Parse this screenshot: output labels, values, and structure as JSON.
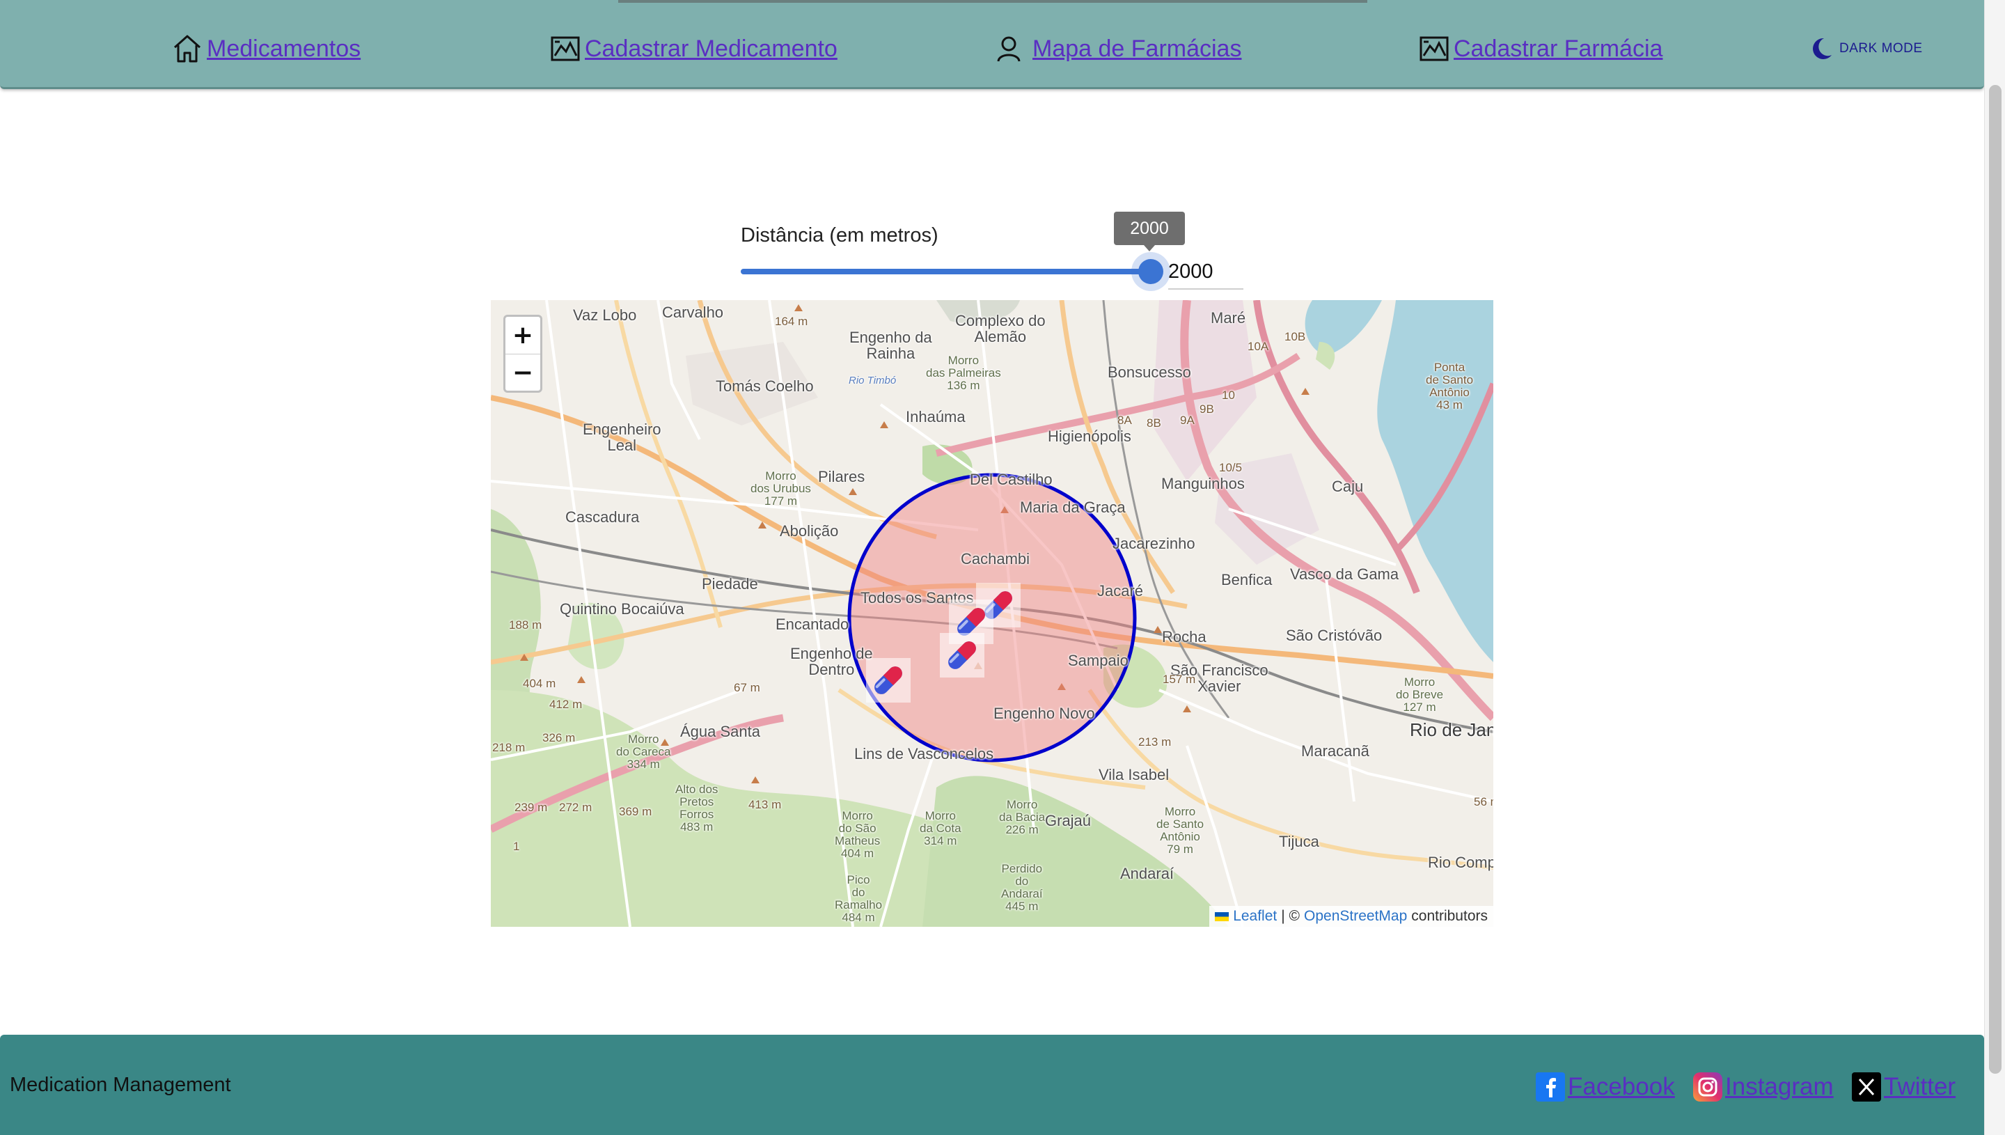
{
  "navbar": {
    "items": [
      {
        "label": "Medicamentos",
        "icon": "home-icon"
      },
      {
        "label": "Cadastrar Medicamento",
        "icon": "image-chart-icon"
      },
      {
        "label": "Mapa de Farmácias",
        "icon": "user-icon"
      },
      {
        "label": "Cadastrar Farmácia",
        "icon": "image-chart-icon"
      }
    ],
    "dark_mode": {
      "label": "DARK MODE",
      "icon": "moon-icon"
    }
  },
  "slider": {
    "label": "Distância (em metros)",
    "value": "2000",
    "tooltip": "2000",
    "fill_fraction": 1.0
  },
  "map": {
    "zoom_in": "+",
    "zoom_out": "−",
    "marker_icon": "pill-capsule-icon",
    "markers_count": 4,
    "attribution": {
      "leaflet": "Leaflet",
      "separator": "| ©",
      "osm": "OpenStreetMap",
      "suffix": "contributors"
    },
    "places": {
      "vaz_lobo": "Vaz Lobo",
      "carvalho": "Carvalho",
      "engenho_rainha": "Engenho da\nRainha",
      "complexo_alemao": "Complexo do\nAlemão",
      "mare": "Maré",
      "ponta": "Ponta\nde Santo\nAntônio\n43 m",
      "morro_palmeiras": "Morro\ndas Palmeiras\n136 m",
      "bonsucesso": "Bonsucesso",
      "tomas_coelho": "Tomás Coelho",
      "rio_timbo": "Rio Timbó",
      "inhauma": "Inhaúma",
      "higienopolis": "Higienópolis",
      "engenheiro_leal": "Engenheiro\nLeal",
      "pilares": "Pilares",
      "morro_urubus": "Morro\ndos Urubus\n177 m",
      "del_castilho": "Del Castilho",
      "manguinhos": "Manguinhos",
      "caju": "Caju",
      "cascadura": "Cascadura",
      "abolicao": "Abolição",
      "maria_graca": "Maria da Graça",
      "cachambi": "Cachambi",
      "jacarezinho": "Jacarezinho",
      "benfica": "Benfica",
      "vasco_gama": "Vasco da Gama",
      "piedade": "Piedade",
      "todos_santos": "Todos os Santos",
      "jacare": "Jacaré",
      "quintino": "Quintino Bocaiúva",
      "encantado": "Encantado",
      "rocha": "Rocha",
      "sao_cristovao": "São Cristóvão",
      "engenho_dentro": "Engenho de\nDentro",
      "sampaio": "Sampaio",
      "sao_francisco": "São Francisco\nXavier",
      "morro_breve": "Morro\ndo Breve\n127 m",
      "rio_janeiro": "Rio de Jan",
      "agua_santa": "Água Santa",
      "engenho_novo": "Engenho Novo",
      "morro_careca": "Morro\ndo Careca\n334 m",
      "lins": "Lins de Vasconcelos",
      "vila_isabel": "Vila Isabel",
      "maracana": "Maracanã",
      "alto_pretos": "Alto dos\nPretos\nForros\n483 m",
      "morro_matheus": "Morro\ndo São\nMatheus\n404 m",
      "morro_cota": "Morro\nda Cota\n314 m",
      "morro_bacia": "Morro\nda Bacia\n226 m",
      "grajau": "Grajaú",
      "morro_santo_antonio": "Morro\nde Santo\nAntônio\n79 m",
      "tijuca": "Tijuca",
      "rio_comp": "Rio Comp",
      "pico_ramalho": "Pico\ndo\nRamalho\n484 m",
      "perdido": "Perdido\ndo\nAndaraí\n445 m",
      "andarai": "Andaraí",
      "e188": "188 m",
      "e404": "404 m",
      "e412": "412 m",
      "e326": "326 m",
      "e218": "218 m",
      "e239": "239 m",
      "e272": "272 m",
      "e369": "369 m",
      "e413": "413 m",
      "e67": "67 m",
      "e164": "164 m",
      "e157": "157 m",
      "e213": "213 m",
      "e56": "56 m",
      "e10a": "10A",
      "e10b": "10B",
      "e8a": "8A",
      "e9a": "9A",
      "e9b": "9B",
      "e10": "10",
      "e8b": "8B",
      "e105": "10/5",
      "e1": "1"
    }
  },
  "footer": {
    "brand": "Medication Management",
    "social": [
      {
        "label": "Facebook",
        "icon": "facebook-icon",
        "color": "#1877f2"
      },
      {
        "label": "Instagram",
        "icon": "instagram-icon",
        "color": "#d6249f"
      },
      {
        "label": "Twitter",
        "icon": "x-twitter-icon",
        "color": "#000000"
      }
    ]
  },
  "colors": {
    "navbar": "#7fb0ae",
    "footer": "#3a8786",
    "link": "#5a2ec2",
    "slider": "#3b74d3",
    "radius_circle": "#0000cc",
    "radius_fill": "#f08080"
  }
}
